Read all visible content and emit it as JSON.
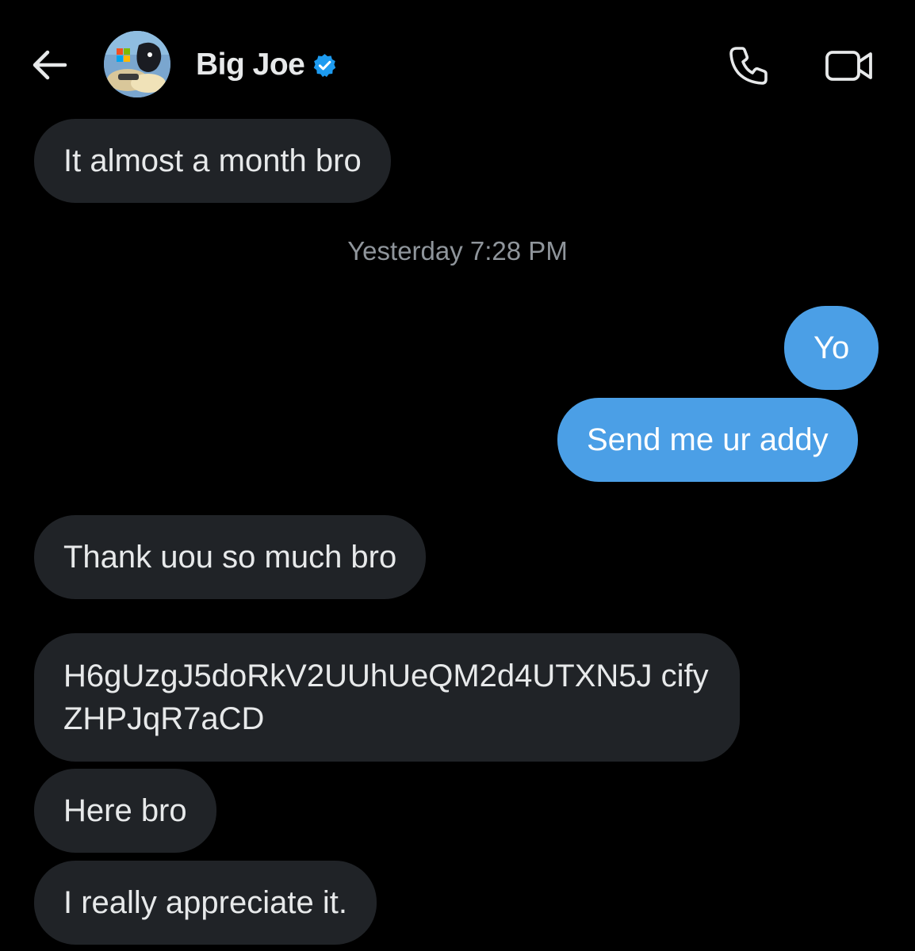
{
  "header": {
    "contact_name": "Big Joe",
    "verified": true,
    "accent_color": "#4b9fe6",
    "icons": [
      "back-arrow-icon",
      "verified-badge-icon",
      "phone-icon",
      "video-camera-icon"
    ]
  },
  "conversation": {
    "messages_before": [
      {
        "direction": "received",
        "text": "It almost a month bro"
      }
    ],
    "timestamp": "Yesterday 7:28 PM",
    "messages_after": [
      {
        "direction": "sent",
        "text": "Yo"
      },
      {
        "direction": "sent",
        "text": "Send me ur addy"
      },
      {
        "direction": "received",
        "text": "Thank uou so much bro"
      },
      {
        "direction": "received",
        "text": "H6gUzgJ5doRkV2UUhUeQM2d4UTXN5J cifyZHPJqR7aCD"
      },
      {
        "direction": "received",
        "text": "Here bro"
      },
      {
        "direction": "received",
        "text": "I really appreciate it."
      }
    ]
  },
  "colors": {
    "background": "#000000",
    "received_bubble": "#202327",
    "sent_bubble": "#4b9fe6",
    "timestamp_text": "#8f959b"
  }
}
